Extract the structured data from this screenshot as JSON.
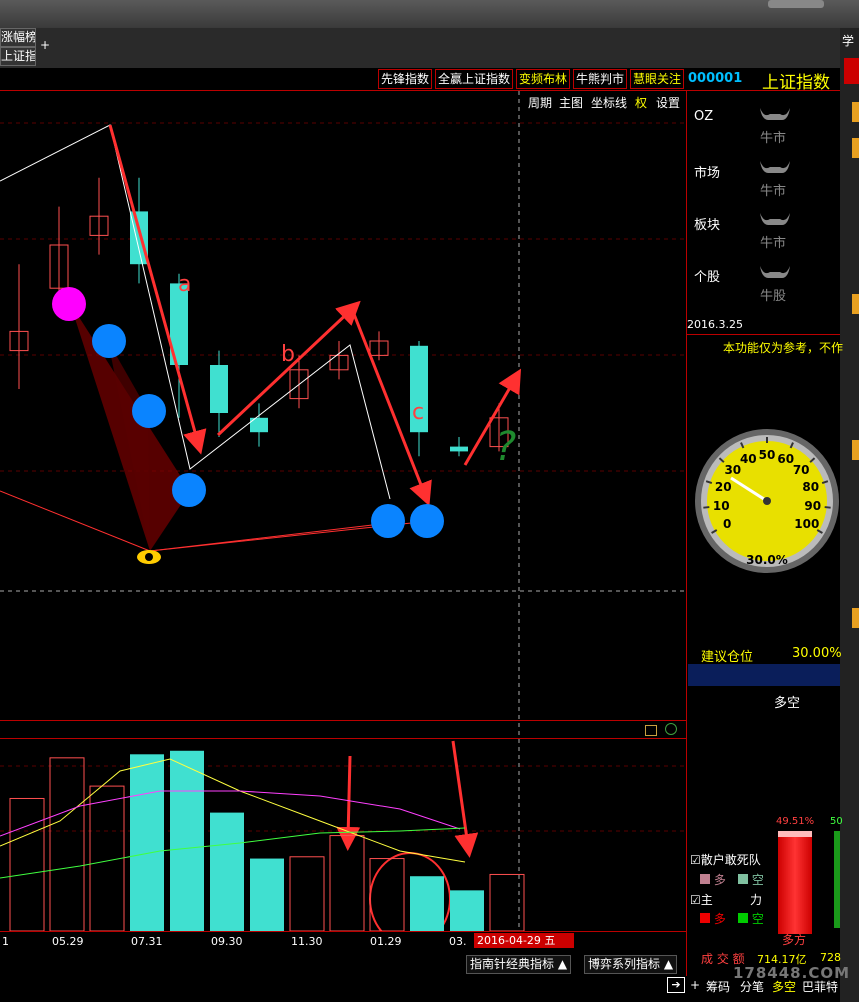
{
  "tabs": {
    "left_tab_1": "涨幅榜",
    "left_tab_2": "上证指数",
    "plus": "+"
  },
  "toolbar": {
    "buttons": [
      "先锋指数",
      "全赢上证指数",
      "变频布林",
      "牛熊判市",
      "慧眼关注"
    ]
  },
  "index": {
    "code": "000001",
    "name": "上证指数"
  },
  "chart_menu": [
    "周期",
    "主图",
    "坐标线",
    "权",
    "设置"
  ],
  "market_rows": [
    {
      "label": "OZ",
      "status": "牛市"
    },
    {
      "label": "市场",
      "status": "牛市"
    },
    {
      "label": "板块",
      "status": "牛市"
    },
    {
      "label": "个股",
      "status": "牛股"
    }
  ],
  "side_panel": {
    "date": "2016.3.25",
    "notice": "本功能仅为参考，不作",
    "gauge_value_text": "30.0%",
    "gauge_ticks": [
      "0",
      "10",
      "20",
      "30",
      "40",
      "50",
      "60",
      "70",
      "80",
      "90",
      "100"
    ],
    "position_label": "建议仓位",
    "position_value": "30.00%",
    "duokong_title": "多空",
    "bar_left_pct": "49.51%",
    "bar_right_pct": "50",
    "check1": "散户敢死队",
    "check1_duo": "多",
    "check1_kong": "空",
    "check2_a": "主",
    "check2_b": "力",
    "check2_duo": "多",
    "check2_kong": "空",
    "bottom_label": "多方",
    "turnover_label": "成 交 额",
    "turnover_value": "714.17亿",
    "turnover_value2": "728",
    "status_items": [
      "筹码",
      "分笔",
      "多空",
      "巴菲特"
    ],
    "watermark": "178448.COM"
  },
  "annotations": {
    "a": "a",
    "b": "b",
    "c": "c",
    "q": "?"
  },
  "xaxis": [
    "1",
    "05.29",
    "07.31",
    "09.30",
    "11.30",
    "01.29",
    "03."
  ],
  "cursor_date": "2016-04-29 五",
  "bottom_buttons": [
    "指南针经典指标 ▲",
    "博弈系列指标 ▲"
  ],
  "colors": {
    "accent_red": "#cc0000",
    "cyan_bar": "#40e0d0",
    "candle_red": "#ff5050",
    "blue_dot": "#0a84ff",
    "magenta_dot": "#ff00ff"
  },
  "chart_data": [
    {
      "type": "candlestick",
      "title": "",
      "xlabel": "",
      "ylabel": "",
      "candles": [
        {
          "open": 0.52,
          "close": 0.48,
          "high": 0.66,
          "low": 0.4,
          "color": "red"
        },
        {
          "open": 0.61,
          "close": 0.7,
          "high": 0.78,
          "low": 0.55,
          "color": "red"
        },
        {
          "open": 0.72,
          "close": 0.76,
          "high": 0.84,
          "low": 0.68,
          "color": "red"
        },
        {
          "open": 0.77,
          "close": 0.66,
          "high": 0.84,
          "low": 0.62,
          "color": "cyan"
        },
        {
          "open": 0.62,
          "close": 0.45,
          "high": 0.64,
          "low": 0.34,
          "color": "cyan"
        },
        {
          "open": 0.45,
          "close": 0.35,
          "high": 0.48,
          "low": 0.3,
          "color": "cyan"
        },
        {
          "open": 0.34,
          "close": 0.31,
          "high": 0.37,
          "low": 0.28,
          "color": "cyan"
        },
        {
          "open": 0.38,
          "close": 0.44,
          "high": 0.47,
          "low": 0.36,
          "color": "red"
        },
        {
          "open": 0.44,
          "close": 0.47,
          "high": 0.5,
          "low": 0.42,
          "color": "red"
        },
        {
          "open": 0.47,
          "close": 0.5,
          "high": 0.52,
          "low": 0.46,
          "color": "red"
        },
        {
          "open": 0.49,
          "close": 0.31,
          "high": 0.5,
          "low": 0.26,
          "color": "cyan"
        },
        {
          "open": 0.28,
          "close": 0.27,
          "high": 0.3,
          "low": 0.26,
          "color": "cyan"
        },
        {
          "open": 0.28,
          "close": 0.34,
          "high": 0.37,
          "low": 0.27,
          "color": "red"
        }
      ],
      "volume": [
        {
          "value": 0.75,
          "color": "red"
        },
        {
          "value": 0.98,
          "color": "red"
        },
        {
          "value": 0.82,
          "color": "red"
        },
        {
          "value": 1.0,
          "color": "cyan"
        },
        {
          "value": 1.02,
          "color": "cyan"
        },
        {
          "value": 0.67,
          "color": "cyan"
        },
        {
          "value": 0.41,
          "color": "cyan"
        },
        {
          "value": 0.42,
          "color": "red"
        },
        {
          "value": 0.54,
          "color": "red"
        },
        {
          "value": 0.41,
          "color": "red"
        },
        {
          "value": 0.31,
          "color": "cyan"
        },
        {
          "value": 0.23,
          "color": "cyan"
        },
        {
          "value": 0.32,
          "color": "red"
        }
      ]
    }
  ]
}
